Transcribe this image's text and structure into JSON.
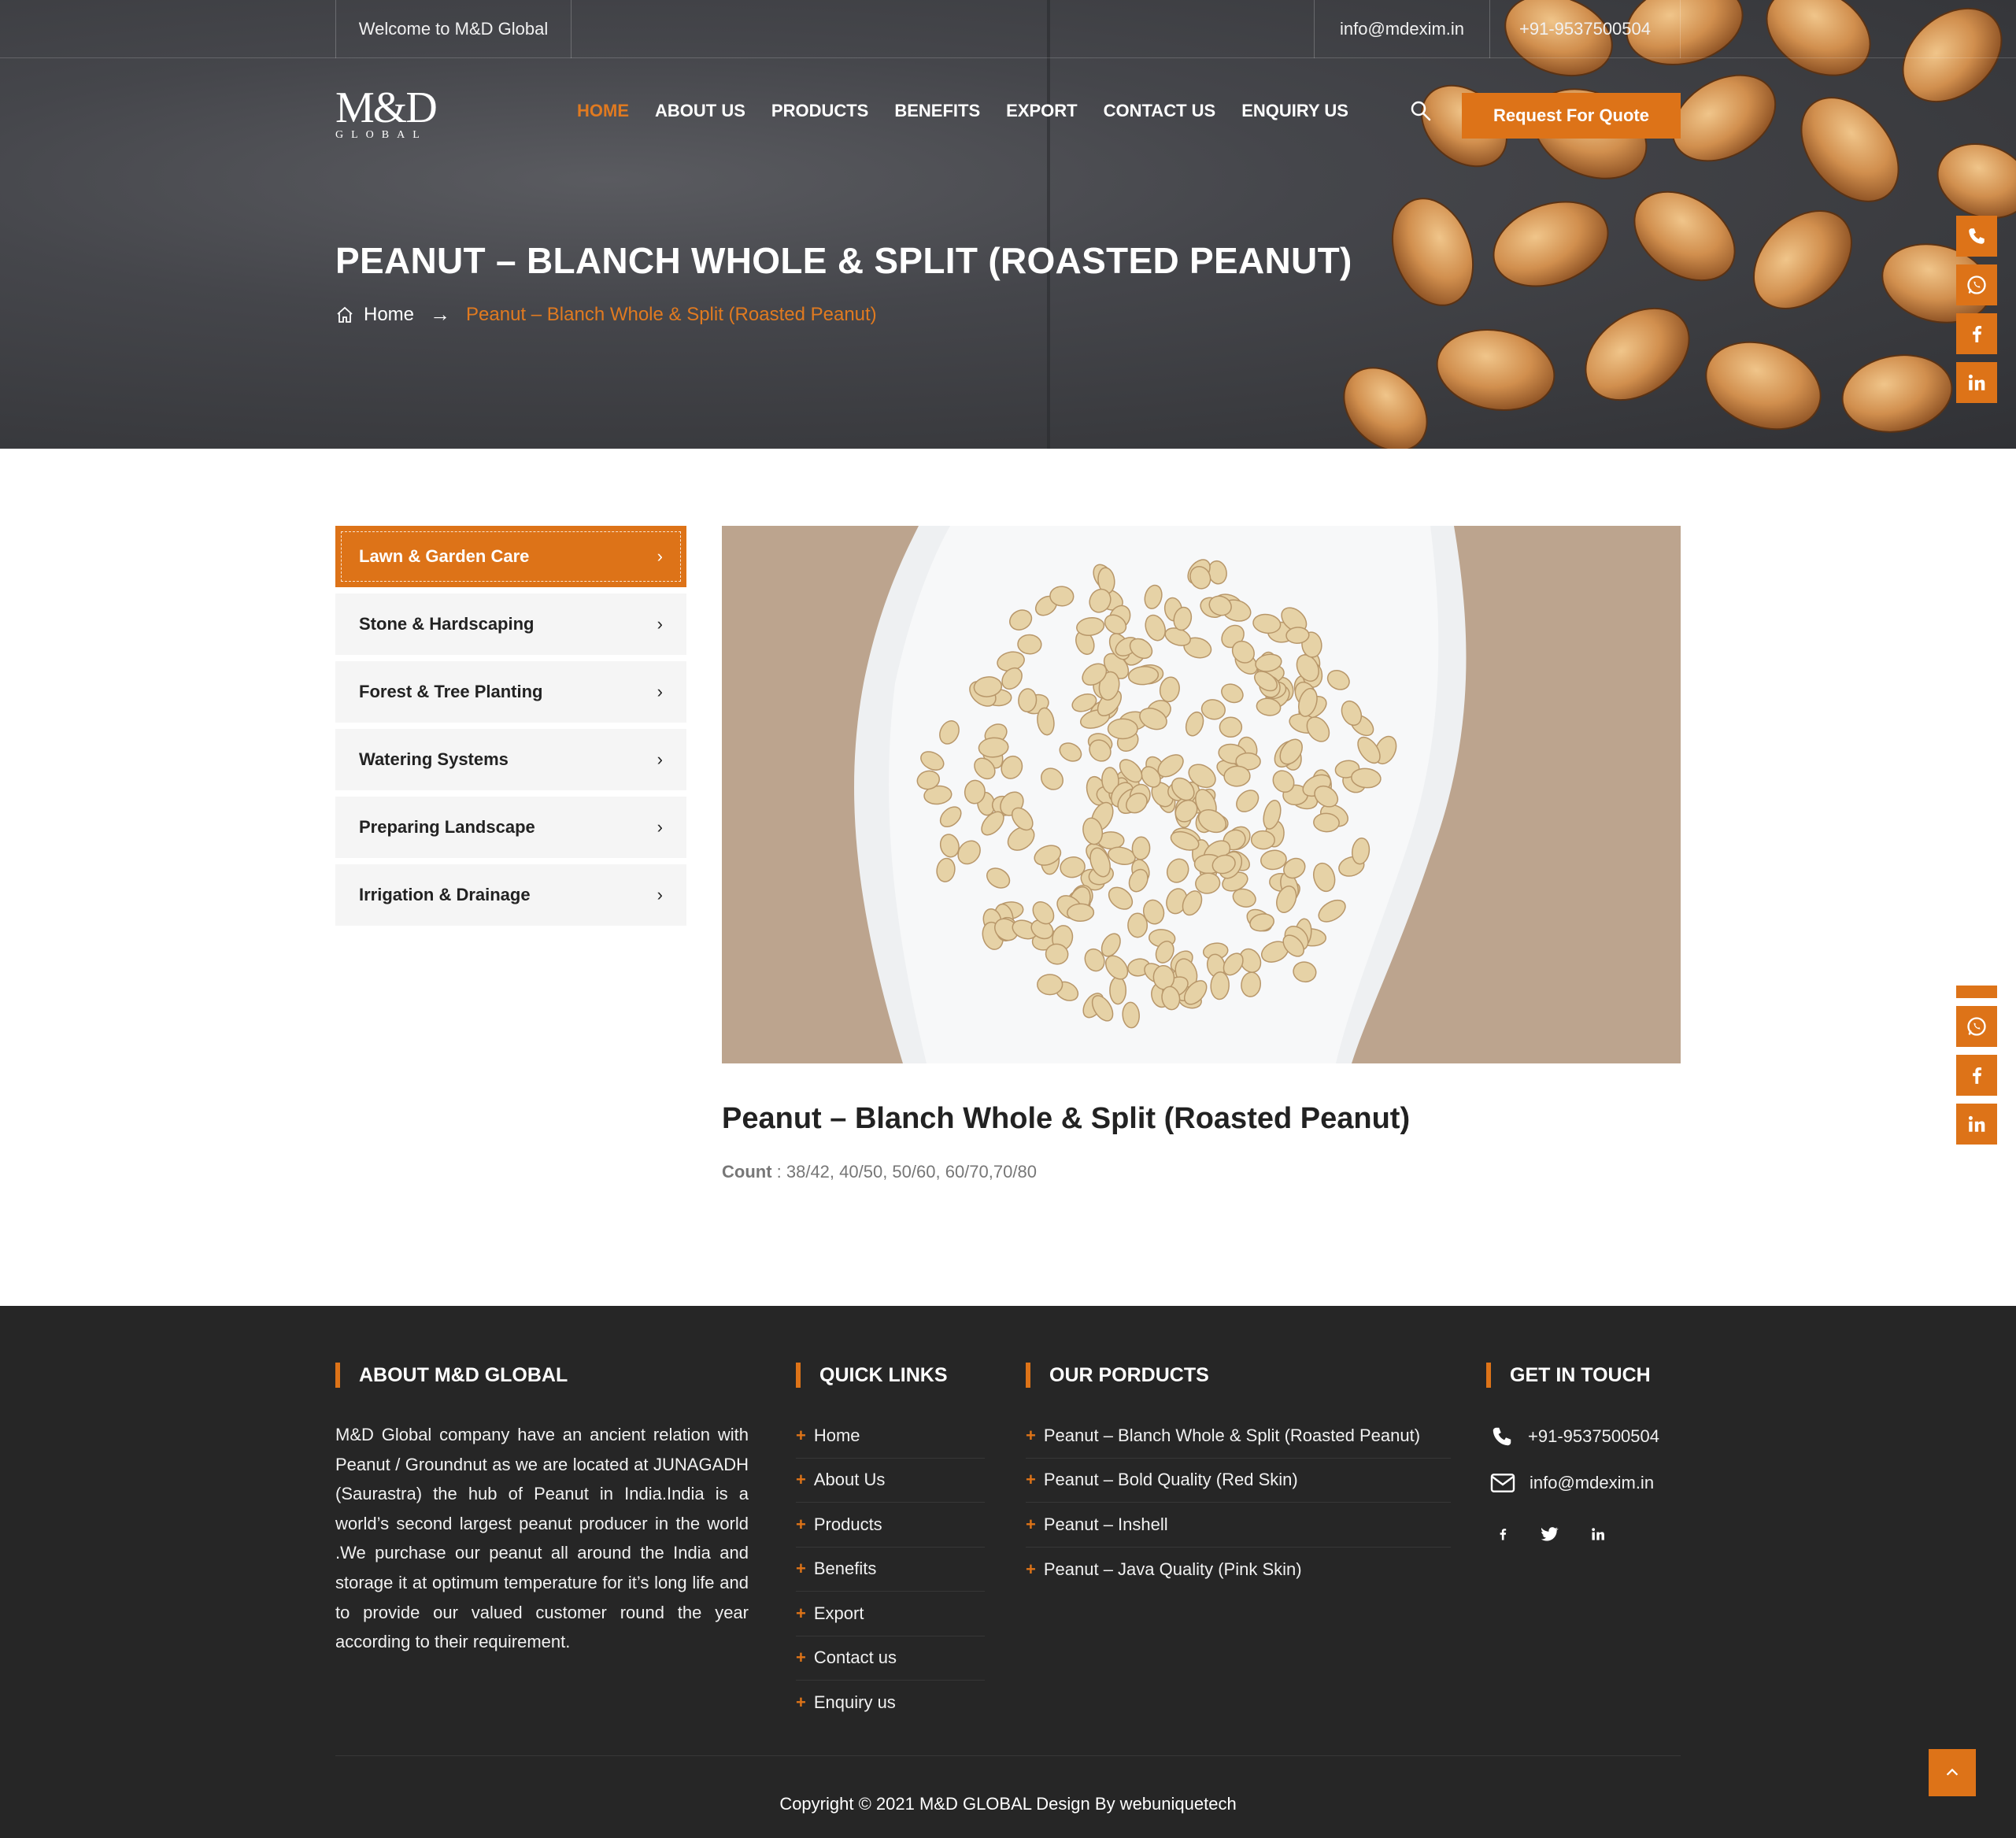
{
  "topbar": {
    "welcome": "Welcome to M&D Global",
    "email": "info@mdexim.in",
    "phone": "+91-9537500504"
  },
  "logo": {
    "mark": "M&D",
    "sub": "GLOBAL"
  },
  "nav": {
    "items": [
      {
        "label": "HOME",
        "active": true
      },
      {
        "label": "ABOUT US"
      },
      {
        "label": "PRODUCTS"
      },
      {
        "label": "BENEFITS"
      },
      {
        "label": "EXPORT"
      },
      {
        "label": "CONTACT US"
      },
      {
        "label": "ENQUIRY US"
      }
    ],
    "quote_button": "Request For Quote"
  },
  "hero": {
    "title": "PEANUT – BLANCH WHOLE & SPLIT (ROASTED PEANUT)",
    "breadcrumb_home": "Home",
    "breadcrumb_arrow": "→",
    "breadcrumb_current": "Peanut – Blanch Whole & Split (Roasted Peanut)"
  },
  "sidebar": {
    "items": [
      {
        "label": "Lawn & Garden Care",
        "active": true
      },
      {
        "label": "Stone & Hardscaping"
      },
      {
        "label": "Forest & Tree Planting"
      },
      {
        "label": "Watering Systems"
      },
      {
        "label": "Preparing Landscape"
      },
      {
        "label": "Irrigation & Drainage"
      }
    ]
  },
  "product": {
    "title": "Peanut – Blanch Whole & Split (Roasted Peanut)",
    "count_label": "Count",
    "count_value": " : 38/42, 40/50, 50/60, 60/70,70/80"
  },
  "footer": {
    "about_heading": "ABOUT M&D GLOBAL",
    "about_text": "M&D Global company have an ancient relation with Peanut / Groundnut as we are located at JUNAGADH (Saurastra) the hub of Peanut in India.India is a world’s second largest peanut producer in the world .We purchase our peanut all around the India and storage it at optimum temperature for it’s long life and to provide our valued customer round the year according to their requirement.",
    "links_heading": "QUICK LINKS",
    "links": [
      "Home",
      "About Us",
      "Products",
      "Benefits",
      "Export",
      "Contact us",
      "Enquiry us"
    ],
    "products_heading": "OUR PORDUCTS",
    "products": [
      "Peanut – Blanch Whole & Split (Roasted Peanut)",
      "Peanut – Bold Quality (Red Skin)",
      "Peanut – Inshell",
      "Peanut – Java Quality (Pink Skin)"
    ],
    "contact_heading": "GET IN TOUCH",
    "phone": "+91-9537500504",
    "email": "info@mdexim.in",
    "copyright": "Copyright © 2021 M&D GLOBAL  Design By webuniquetech"
  },
  "icons": {
    "accent": "#dd7318",
    "social": [
      "phone-icon",
      "whatsapp-icon",
      "facebook-icon",
      "linkedin-icon"
    ],
    "footer_social": [
      "facebook-icon",
      "twitter-icon",
      "linkedin-icon"
    ]
  }
}
